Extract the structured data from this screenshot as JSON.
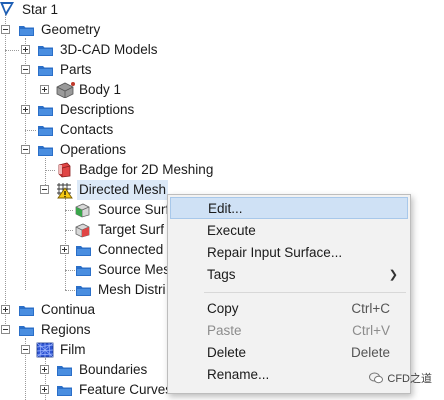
{
  "tree": {
    "root": "Star 1",
    "geometry": "Geometry",
    "cad_models": "3D-CAD Models",
    "parts": "Parts",
    "body1": "Body 1",
    "descriptions": "Descriptions",
    "contacts": "Contacts",
    "operations": "Operations",
    "badge": "Badge for 2D Meshing",
    "directed_mesh": "Directed Mesh",
    "source_surf": "Source Surf",
    "target_surf": "Target Surf",
    "connected": "Connected",
    "source_mesh": "Source Mes",
    "mesh_distri": "Mesh Distri",
    "continua": "Continua",
    "regions": "Regions",
    "film": "Film",
    "boundaries": "Boundaries",
    "feature_curves": "Feature Curves"
  },
  "context_menu": {
    "edit": "Edit...",
    "execute": "Execute",
    "repair": "Repair Input Surface...",
    "tags": "Tags",
    "copy": "Copy",
    "copy_key": "Ctrl+C",
    "paste": "Paste",
    "paste_key": "Ctrl+V",
    "delete": "Delete",
    "delete_key": "Delete",
    "rename": "Rename..."
  },
  "watermark": "CFD之道",
  "colors": {
    "selection": "#dce9f7",
    "menu_hover": "#cfe1f5",
    "folder": "#2b6fc8"
  }
}
